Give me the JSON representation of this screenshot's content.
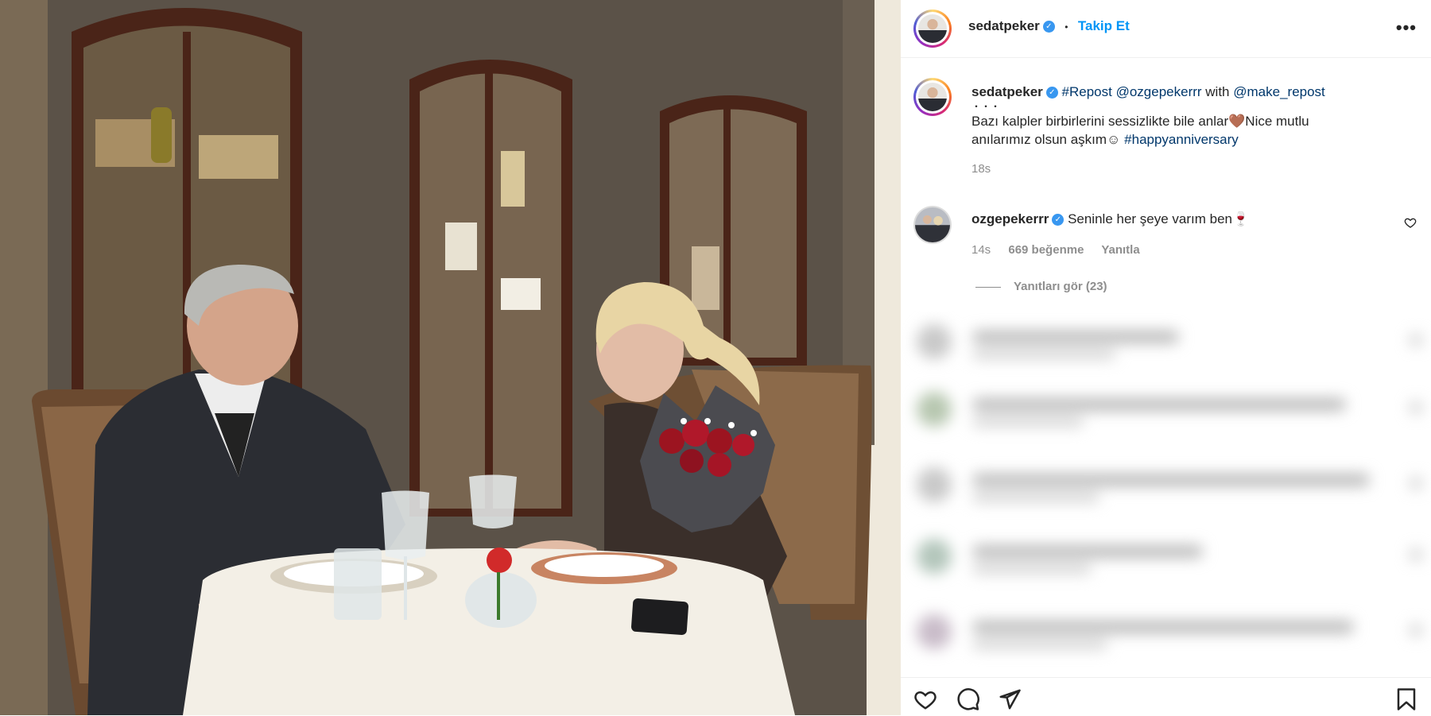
{
  "post": {
    "author": "sedatpeker",
    "separator": "•",
    "follow_label": "Takip Et",
    "more_icon": "more-horizontal-icon"
  },
  "caption": {
    "author": "sedatpeker",
    "repost_tag": "#Repost",
    "repost_user": "@ozgepekerrr",
    "with_word": "with",
    "repost_app": "@make_repost",
    "dots": "・・・",
    "text_1": "Bazı kalpler birbirlerini sessizlikte bile anlar🤎Nice mutlu",
    "text_2": "anılarımız olsun aşkım☺",
    "hashtag": "#happyanniversary",
    "time": "18s"
  },
  "comment": {
    "author": "ozgepekerrr",
    "text": "Seninle her şeye varım ben🍷",
    "time": "14s",
    "likes": "669 beğenme",
    "reply_label": "Yanıtla",
    "view_replies": "Yanıtları gör (23)"
  },
  "actions": {
    "like_icon": "heart-icon",
    "comment_icon": "comment-icon",
    "share_icon": "send-icon",
    "save_icon": "bookmark-icon"
  },
  "colors": {
    "follow": "#0095f6",
    "verified": "#3897f0",
    "hashtag": "#00376b"
  }
}
